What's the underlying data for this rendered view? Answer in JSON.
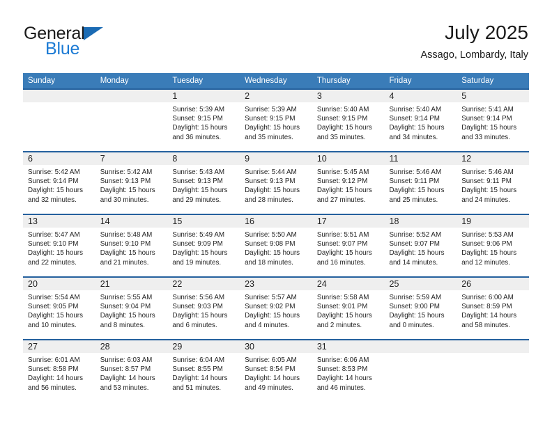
{
  "brand": {
    "name_top": "General",
    "name_bottom": "Blue",
    "triangle_color": "#1b6bb4",
    "blue_text_color": "#1b7ad4"
  },
  "header": {
    "title": "July 2025",
    "location": "Assago, Lombardy, Italy"
  },
  "theme": {
    "header_blue": "#3a7cb8",
    "row_line_blue": "#25619e",
    "daynum_band": "#efefef"
  },
  "weekday_headers": [
    "Sunday",
    "Monday",
    "Tuesday",
    "Wednesday",
    "Thursday",
    "Friday",
    "Saturday"
  ],
  "weeks": [
    [
      {
        "day": "",
        "sunrise": "",
        "sunset": "",
        "daylight": ""
      },
      {
        "day": "",
        "sunrise": "",
        "sunset": "",
        "daylight": ""
      },
      {
        "day": "1",
        "sunrise": "Sunrise: 5:39 AM",
        "sunset": "Sunset: 9:15 PM",
        "daylight": "Daylight: 15 hours and 36 minutes."
      },
      {
        "day": "2",
        "sunrise": "Sunrise: 5:39 AM",
        "sunset": "Sunset: 9:15 PM",
        "daylight": "Daylight: 15 hours and 35 minutes."
      },
      {
        "day": "3",
        "sunrise": "Sunrise: 5:40 AM",
        "sunset": "Sunset: 9:15 PM",
        "daylight": "Daylight: 15 hours and 35 minutes."
      },
      {
        "day": "4",
        "sunrise": "Sunrise: 5:40 AM",
        "sunset": "Sunset: 9:14 PM",
        "daylight": "Daylight: 15 hours and 34 minutes."
      },
      {
        "day": "5",
        "sunrise": "Sunrise: 5:41 AM",
        "sunset": "Sunset: 9:14 PM",
        "daylight": "Daylight: 15 hours and 33 minutes."
      }
    ],
    [
      {
        "day": "6",
        "sunrise": "Sunrise: 5:42 AM",
        "sunset": "Sunset: 9:14 PM",
        "daylight": "Daylight: 15 hours and 32 minutes."
      },
      {
        "day": "7",
        "sunrise": "Sunrise: 5:42 AM",
        "sunset": "Sunset: 9:13 PM",
        "daylight": "Daylight: 15 hours and 30 minutes."
      },
      {
        "day": "8",
        "sunrise": "Sunrise: 5:43 AM",
        "sunset": "Sunset: 9:13 PM",
        "daylight": "Daylight: 15 hours and 29 minutes."
      },
      {
        "day": "9",
        "sunrise": "Sunrise: 5:44 AM",
        "sunset": "Sunset: 9:13 PM",
        "daylight": "Daylight: 15 hours and 28 minutes."
      },
      {
        "day": "10",
        "sunrise": "Sunrise: 5:45 AM",
        "sunset": "Sunset: 9:12 PM",
        "daylight": "Daylight: 15 hours and 27 minutes."
      },
      {
        "day": "11",
        "sunrise": "Sunrise: 5:46 AM",
        "sunset": "Sunset: 9:11 PM",
        "daylight": "Daylight: 15 hours and 25 minutes."
      },
      {
        "day": "12",
        "sunrise": "Sunrise: 5:46 AM",
        "sunset": "Sunset: 9:11 PM",
        "daylight": "Daylight: 15 hours and 24 minutes."
      }
    ],
    [
      {
        "day": "13",
        "sunrise": "Sunrise: 5:47 AM",
        "sunset": "Sunset: 9:10 PM",
        "daylight": "Daylight: 15 hours and 22 minutes."
      },
      {
        "day": "14",
        "sunrise": "Sunrise: 5:48 AM",
        "sunset": "Sunset: 9:10 PM",
        "daylight": "Daylight: 15 hours and 21 minutes."
      },
      {
        "day": "15",
        "sunrise": "Sunrise: 5:49 AM",
        "sunset": "Sunset: 9:09 PM",
        "daylight": "Daylight: 15 hours and 19 minutes."
      },
      {
        "day": "16",
        "sunrise": "Sunrise: 5:50 AM",
        "sunset": "Sunset: 9:08 PM",
        "daylight": "Daylight: 15 hours and 18 minutes."
      },
      {
        "day": "17",
        "sunrise": "Sunrise: 5:51 AM",
        "sunset": "Sunset: 9:07 PM",
        "daylight": "Daylight: 15 hours and 16 minutes."
      },
      {
        "day": "18",
        "sunrise": "Sunrise: 5:52 AM",
        "sunset": "Sunset: 9:07 PM",
        "daylight": "Daylight: 15 hours and 14 minutes."
      },
      {
        "day": "19",
        "sunrise": "Sunrise: 5:53 AM",
        "sunset": "Sunset: 9:06 PM",
        "daylight": "Daylight: 15 hours and 12 minutes."
      }
    ],
    [
      {
        "day": "20",
        "sunrise": "Sunrise: 5:54 AM",
        "sunset": "Sunset: 9:05 PM",
        "daylight": "Daylight: 15 hours and 10 minutes."
      },
      {
        "day": "21",
        "sunrise": "Sunrise: 5:55 AM",
        "sunset": "Sunset: 9:04 PM",
        "daylight": "Daylight: 15 hours and 8 minutes."
      },
      {
        "day": "22",
        "sunrise": "Sunrise: 5:56 AM",
        "sunset": "Sunset: 9:03 PM",
        "daylight": "Daylight: 15 hours and 6 minutes."
      },
      {
        "day": "23",
        "sunrise": "Sunrise: 5:57 AM",
        "sunset": "Sunset: 9:02 PM",
        "daylight": "Daylight: 15 hours and 4 minutes."
      },
      {
        "day": "24",
        "sunrise": "Sunrise: 5:58 AM",
        "sunset": "Sunset: 9:01 PM",
        "daylight": "Daylight: 15 hours and 2 minutes."
      },
      {
        "day": "25",
        "sunrise": "Sunrise: 5:59 AM",
        "sunset": "Sunset: 9:00 PM",
        "daylight": "Daylight: 15 hours and 0 minutes."
      },
      {
        "day": "26",
        "sunrise": "Sunrise: 6:00 AM",
        "sunset": "Sunset: 8:59 PM",
        "daylight": "Daylight: 14 hours and 58 minutes."
      }
    ],
    [
      {
        "day": "27",
        "sunrise": "Sunrise: 6:01 AM",
        "sunset": "Sunset: 8:58 PM",
        "daylight": "Daylight: 14 hours and 56 minutes."
      },
      {
        "day": "28",
        "sunrise": "Sunrise: 6:03 AM",
        "sunset": "Sunset: 8:57 PM",
        "daylight": "Daylight: 14 hours and 53 minutes."
      },
      {
        "day": "29",
        "sunrise": "Sunrise: 6:04 AM",
        "sunset": "Sunset: 8:55 PM",
        "daylight": "Daylight: 14 hours and 51 minutes."
      },
      {
        "day": "30",
        "sunrise": "Sunrise: 6:05 AM",
        "sunset": "Sunset: 8:54 PM",
        "daylight": "Daylight: 14 hours and 49 minutes."
      },
      {
        "day": "31",
        "sunrise": "Sunrise: 6:06 AM",
        "sunset": "Sunset: 8:53 PM",
        "daylight": "Daylight: 14 hours and 46 minutes."
      },
      {
        "day": "",
        "sunrise": "",
        "sunset": "",
        "daylight": ""
      },
      {
        "day": "",
        "sunrise": "",
        "sunset": "",
        "daylight": ""
      }
    ]
  ]
}
